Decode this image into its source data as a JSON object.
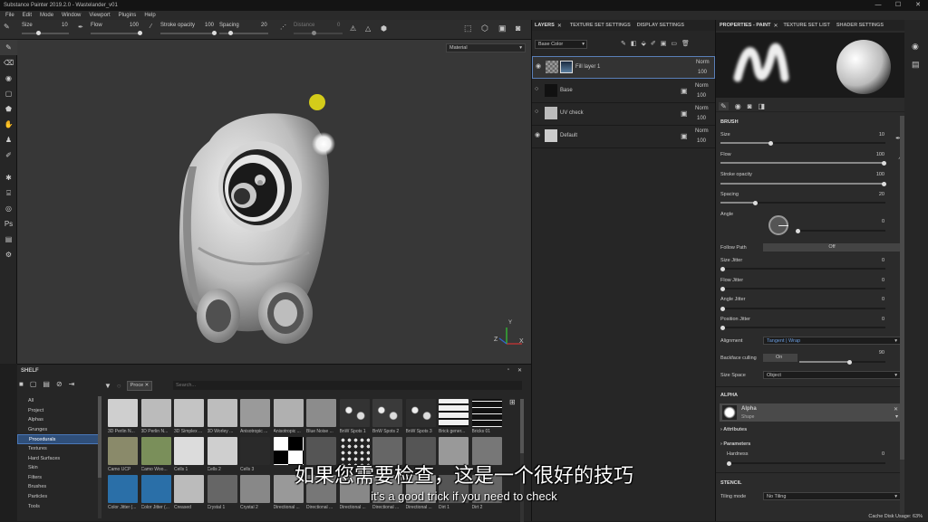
{
  "window": {
    "title": "Substance Painter 2019.2.0 - Wastelander_v01",
    "min": "—",
    "max": "☐",
    "close": "✕"
  },
  "menu": [
    "File",
    "Edit",
    "Mode",
    "Window",
    "Viewport",
    "Plugins",
    "Help"
  ],
  "toolbar": {
    "size_label": "Size",
    "size_value": "10",
    "flow_label": "Flow",
    "flow_value": "100",
    "stroke_label": "Stroke opacity",
    "stroke_value": "100",
    "spacing_label": "Spacing",
    "spacing_value": "20",
    "distance_label": "Distance",
    "distance_value": "0"
  },
  "viewport": {
    "material_mode": "Material",
    "axes": {
      "x": "X",
      "y": "Y",
      "z": "Z"
    }
  },
  "shelf": {
    "title": "SHELF",
    "filter_tag": "Proce",
    "search_placeholder": "Search...",
    "categories": [
      "All",
      "Project",
      "Alphas",
      "Grunges",
      "Procedurals",
      "Textures",
      "Hard Surfaces",
      "Skin",
      "Filters",
      "Brushes",
      "Particles",
      "Tools"
    ],
    "selected_category": "Procedurals",
    "thumbs_row1": [
      "3D Perlin N...",
      "3D Perlin N...",
      "3D Simplex ...",
      "3D Worley ...",
      "Anisotropic ...",
      "Anisotropic ...",
      "Blue Noise ...",
      "BnW Spots 1",
      "BnW Spots 2",
      "BnW Spots 3",
      "Brick gener...",
      "Bricks 01"
    ],
    "thumbs_row2": [
      "Camo UCP",
      "Camo Woo...",
      "Cells 1",
      "Cells 2",
      "Cells 3",
      "",
      "",
      "",
      "",
      "",
      "",
      ""
    ],
    "thumbs_row3": [
      "Color Jitter (...",
      "Color Jitter (...",
      "Creased",
      "Crystal 1",
      "Crystal 2",
      "Directional ...",
      "Directional ...",
      "Directional ...",
      "Directional ...",
      "Directional ...",
      "Dirt 1",
      "Dirt 2"
    ]
  },
  "layers": {
    "tabs": [
      "LAYERS",
      "TEXTURE SET SETTINGS",
      "DISPLAY SETTINGS"
    ],
    "channel": "Base Color",
    "items": [
      {
        "name": "Fill layer 1",
        "blend": "Norm",
        "opacity": "100"
      },
      {
        "name": "Base",
        "blend": "Norm",
        "opacity": "100"
      },
      {
        "name": "UV check",
        "blend": "Norm",
        "opacity": "100"
      },
      {
        "name": "Default",
        "blend": "Norm",
        "opacity": "100"
      }
    ]
  },
  "props": {
    "tabs": [
      "PROPERTIES - PAINT",
      "TEXTURE SET LIST",
      "SHADER SETTINGS"
    ],
    "brush_header": "BRUSH",
    "size_label": "Size",
    "size_value": "10",
    "flow_label": "Flow",
    "flow_value": "100",
    "stroke_label": "Stroke opacity",
    "stroke_value": "100",
    "spacing_label": "Spacing",
    "spacing_value": "20",
    "angle_label": "Angle",
    "angle_value": "0",
    "follow_path_label": "Follow Path",
    "follow_path_value": "Off",
    "size_jitter_label": "Size Jitter",
    "size_jitter_value": "0",
    "flow_jitter_label": "Flow Jitter",
    "flow_jitter_value": "0",
    "angle_jitter_label": "Angle Jitter",
    "angle_jitter_value": "0",
    "position_jitter_label": "Position Jitter",
    "position_jitter_value": "0",
    "alignment_label": "Alignment",
    "alignment_value": "Tangent | Wrap",
    "backface_label": "Backface culling",
    "backface_value": "On",
    "backface_num": "90",
    "sizespace_label": "Size Space",
    "sizespace_value": "Object",
    "alpha_header": "ALPHA",
    "alpha_name": "Alpha",
    "alpha_sub": "Shape",
    "attributes_label": "Attributes",
    "parameters_label": "Parameters",
    "hardness_label": "Hardness",
    "hardness_value": "0",
    "stencil_header": "STENCIL",
    "tiling_label": "Tiling mode",
    "tiling_value": "No Tiling"
  },
  "subtitles": {
    "cn": "如果您需要检查，这是一个很好的技巧",
    "en": "it's a good trick if you need to check"
  },
  "status": {
    "cache": "Cache Disk Usage:",
    "cache_value": "63%"
  }
}
